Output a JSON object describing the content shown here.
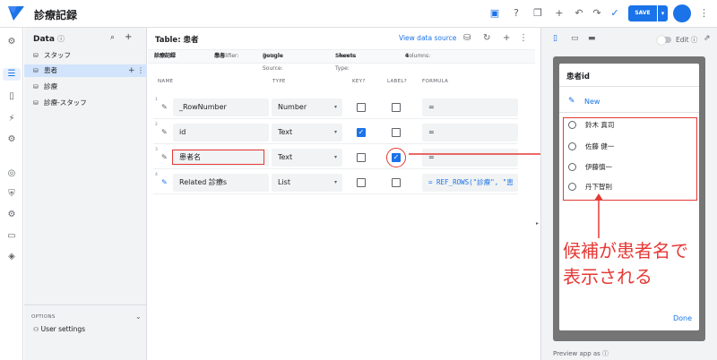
{
  "app": {
    "title": "診療記録",
    "save_label": "SAVE"
  },
  "data_panel": {
    "title": "Data",
    "tables": [
      {
        "label": "スタッフ",
        "selected": false
      },
      {
        "label": "患者",
        "selected": true
      },
      {
        "label": "診療",
        "selected": false
      },
      {
        "label": "診療-スタッフ",
        "selected": false
      }
    ],
    "options_label": "OPTIONS",
    "user_settings": "User settings"
  },
  "table": {
    "title": "Table: 患者",
    "view_source": "View data source",
    "source_label": "Source:",
    "source_value": "診療記録",
    "qualifier_label": "Qualifier:",
    "qualifier_value": "患者",
    "datasource_label": "Data Source:",
    "datasource_value": "google",
    "sourcetype_label": "Source Type:",
    "sourcetype_value": "Sheets",
    "columns_label": "Columns:",
    "columns_value": "4",
    "headers": {
      "name": "NAME",
      "type": "TYPE",
      "key": "KEY?",
      "label": "LABEL?",
      "formula": "FORMULA"
    },
    "rows": [
      {
        "num": "1",
        "name": "_RowNumber",
        "type": "Number",
        "key": false,
        "label": false,
        "formula": "="
      },
      {
        "num": "2",
        "name": "id",
        "type": "Text",
        "key": true,
        "label": false,
        "formula": "="
      },
      {
        "num": "3",
        "name": "患者名",
        "type": "Text",
        "key": false,
        "label": true,
        "formula": "="
      },
      {
        "num": "4",
        "name": "Related 診療s",
        "type": "List",
        "key": false,
        "label": false,
        "formula": "= REF_ROWS(\"診療\", \"患"
      }
    ]
  },
  "preview": {
    "edit_label": "Edit",
    "dialog_title": "患者id",
    "new_label": "New",
    "options": [
      "鈴木 真司",
      "佐藤 健一",
      "伊藤慎一",
      "丹下智則"
    ],
    "done_label": "Done",
    "preview_as": "Preview app as"
  },
  "annotation": {
    "line1": "候補が患者名で",
    "line2": "表示される"
  },
  "colors": {
    "accent": "#1a73e8",
    "annotation_red": "#e53935"
  }
}
